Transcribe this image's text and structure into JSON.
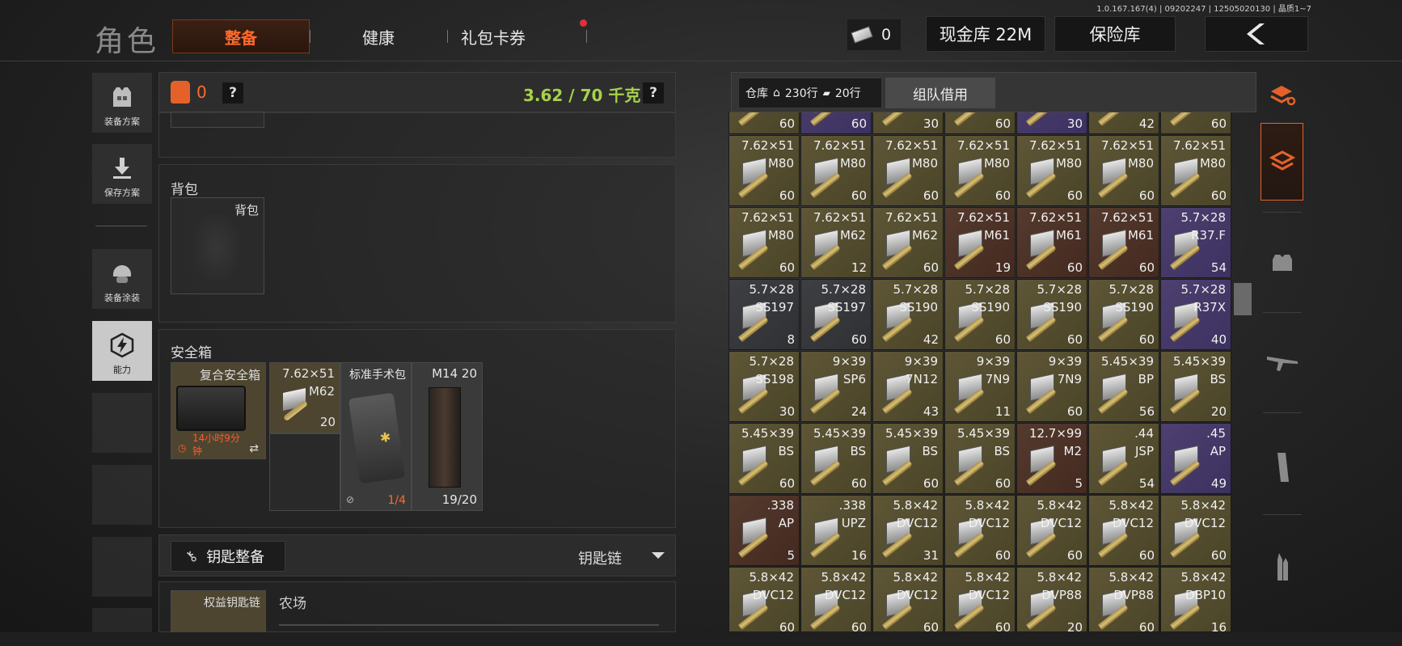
{
  "version_text": "1.0.167.167(4) | 09202247 | 12505020130 | 晶质1~7",
  "header": {
    "title": "角色",
    "tabs": [
      "整备",
      "健康",
      "礼包卡券"
    ],
    "cash_count": "0",
    "cash_vault_label": "现金库 22M",
    "safe_vault_label": "保险库",
    "back_icon": "chevron-left-icon"
  },
  "sidebar": {
    "items": [
      {
        "label": "装备方案",
        "icon": "vest-icon"
      },
      {
        "label": "保存方案",
        "icon": "download-icon"
      },
      {
        "label": "装备涂装",
        "icon": "helmet-icon"
      },
      {
        "label": "能力",
        "icon": "ability-icon"
      }
    ]
  },
  "loadout": {
    "backpack_count": "0",
    "help_mark": "?",
    "weight": "3.62 / 70 千克",
    "backpack_section": "背包",
    "backpack_slot_label": "背包",
    "safebox_section": "安全箱",
    "safebox": {
      "case_name": "复合安全箱",
      "case_timer_line1": "14小时9分",
      "case_timer_line2": "钟",
      "ammo_caliber": "7.62×51",
      "ammo_type": "M62",
      "ammo_count": "20",
      "medkit_name": "标准手术包",
      "medkit_uses": "1/4",
      "mag_name": "M14 20",
      "mag_count": "19/20"
    },
    "key_button": "钥匙整备",
    "keychain_dropdown": "钥匙链",
    "keychain_item": "权益钥匙链",
    "keychain_location": "农场"
  },
  "warehouse": {
    "label": "仓库",
    "rows_used": "230行",
    "rows_free": "20行",
    "team_borrow": "组队借用",
    "partial_row": [
      {
        "count": "60",
        "color": "olive"
      },
      {
        "count": "60",
        "color": "purple"
      },
      {
        "count": "30",
        "color": "olive"
      },
      {
        "count": "60",
        "color": "olive"
      },
      {
        "count": "30",
        "color": "purple"
      },
      {
        "count": "42",
        "color": "olive"
      },
      {
        "count": "60",
        "color": "olive"
      }
    ],
    "rows": [
      [
        {
          "cal": "7.62×51",
          "type": "M80",
          "count": "60",
          "color": "olive"
        },
        {
          "cal": "7.62×51",
          "type": "M80",
          "count": "60",
          "color": "olive"
        },
        {
          "cal": "7.62×51",
          "type": "M80",
          "count": "60",
          "color": "olive"
        },
        {
          "cal": "7.62×51",
          "type": "M80",
          "count": "60",
          "color": "olive"
        },
        {
          "cal": "7.62×51",
          "type": "M80",
          "count": "60",
          "color": "olive"
        },
        {
          "cal": "7.62×51",
          "type": "M80",
          "count": "60",
          "color": "olive"
        },
        {
          "cal": "7.62×51",
          "type": "M80",
          "count": "60",
          "color": "olive"
        }
      ],
      [
        {
          "cal": "7.62×51",
          "type": "M80",
          "count": "60",
          "color": "olive"
        },
        {
          "cal": "7.62×51",
          "type": "M62",
          "count": "12",
          "color": "olive"
        },
        {
          "cal": "7.62×51",
          "type": "M62",
          "count": "60",
          "color": "olive"
        },
        {
          "cal": "7.62×51",
          "type": "M61",
          "count": "19",
          "color": "red"
        },
        {
          "cal": "7.62×51",
          "type": "M61",
          "count": "60",
          "color": "red"
        },
        {
          "cal": "7.62×51",
          "type": "M61",
          "count": "60",
          "color": "red"
        },
        {
          "cal": "5.7×28",
          "type": "R37.F",
          "count": "54",
          "color": "purple"
        }
      ],
      [
        {
          "cal": "5.7×28",
          "type": "SS197",
          "count": "8",
          "color": "gray"
        },
        {
          "cal": "5.7×28",
          "type": "SS197",
          "count": "60",
          "color": "gray"
        },
        {
          "cal": "5.7×28",
          "type": "SS190",
          "count": "42",
          "color": "olive"
        },
        {
          "cal": "5.7×28",
          "type": "SS190",
          "count": "60",
          "color": "olive"
        },
        {
          "cal": "5.7×28",
          "type": "SS190",
          "count": "60",
          "color": "olive"
        },
        {
          "cal": "5.7×28",
          "type": "SS190",
          "count": "60",
          "color": "olive"
        },
        {
          "cal": "5.7×28",
          "type": "R37X",
          "count": "40",
          "color": "purple"
        }
      ],
      [
        {
          "cal": "5.7×28",
          "type": "SS198",
          "count": "30",
          "color": "olive"
        },
        {
          "cal": "9×39",
          "type": "SP6",
          "count": "24",
          "color": "olive"
        },
        {
          "cal": "9×39",
          "type": "7N12",
          "count": "43",
          "color": "olive"
        },
        {
          "cal": "9×39",
          "type": "7N9",
          "count": "11",
          "color": "olive"
        },
        {
          "cal": "9×39",
          "type": "7N9",
          "count": "60",
          "color": "olive"
        },
        {
          "cal": "5.45×39",
          "type": "BP",
          "count": "56",
          "color": "olive"
        },
        {
          "cal": "5.45×39",
          "type": "BS",
          "count": "20",
          "color": "olive"
        }
      ],
      [
        {
          "cal": "5.45×39",
          "type": "BS",
          "count": "60",
          "color": "olive"
        },
        {
          "cal": "5.45×39",
          "type": "BS",
          "count": "60",
          "color": "olive"
        },
        {
          "cal": "5.45×39",
          "type": "BS",
          "count": "60",
          "color": "olive"
        },
        {
          "cal": "5.45×39",
          "type": "BS",
          "count": "60",
          "color": "olive"
        },
        {
          "cal": "12.7×99",
          "type": "M2",
          "count": "5",
          "color": "red"
        },
        {
          "cal": ".44",
          "type": "JSP",
          "count": "54",
          "color": "olive"
        },
        {
          "cal": ".45",
          "type": "AP",
          "count": "49",
          "color": "purple"
        }
      ],
      [
        {
          "cal": ".338",
          "type": "AP",
          "count": "5",
          "color": "red"
        },
        {
          "cal": ".338",
          "type": "UPZ",
          "count": "16",
          "color": "olive"
        },
        {
          "cal": "5.8×42",
          "type": "DVC12",
          "count": "31",
          "color": "olive"
        },
        {
          "cal": "5.8×42",
          "type": "DVC12",
          "count": "60",
          "color": "olive"
        },
        {
          "cal": "5.8×42",
          "type": "DVC12",
          "count": "60",
          "color": "olive"
        },
        {
          "cal": "5.8×42",
          "type": "DVC12",
          "count": "60",
          "color": "olive"
        },
        {
          "cal": "5.8×42",
          "type": "DVC12",
          "count": "60",
          "color": "olive"
        }
      ],
      [
        {
          "cal": "5.8×42",
          "type": "DVC12",
          "count": "60",
          "color": "olive"
        },
        {
          "cal": "5.8×42",
          "type": "DVC12",
          "count": "60",
          "color": "olive"
        },
        {
          "cal": "5.8×42",
          "type": "DVC12",
          "count": "60",
          "color": "olive"
        },
        {
          "cal": "5.8×42",
          "type": "DVC12",
          "count": "60",
          "color": "olive"
        },
        {
          "cal": "5.8×42",
          "type": "DVP88",
          "count": "20",
          "color": "olive"
        },
        {
          "cal": "5.8×42",
          "type": "DVP88",
          "count": "60",
          "color": "olive"
        },
        {
          "cal": "5.8×42",
          "type": "DBP10",
          "count": "16",
          "color": "olive"
        }
      ]
    ]
  },
  "right_rail": [
    "sort-icon",
    "all-items-icon",
    "armor-icon",
    "rifle-icon",
    "magazine-icon",
    "ammo-icon"
  ],
  "colors": {
    "accent": "#ff6a2b",
    "weight_ok": "#a6d14b"
  }
}
